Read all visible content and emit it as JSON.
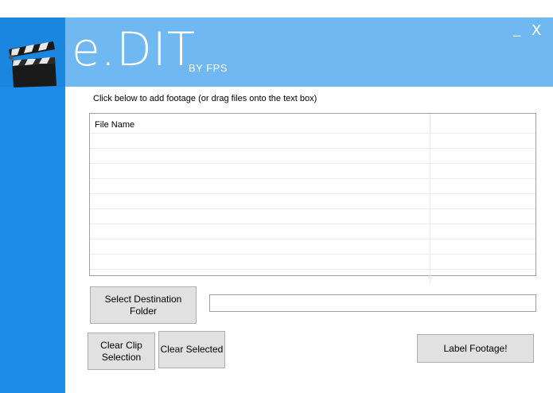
{
  "header": {
    "brand_main": "e.DIT",
    "brand_sub": "BY FPS",
    "minimize_label": "_",
    "close_label": "X"
  },
  "instructions": "Click below to add footage (or drag files onto the text box)",
  "file_table": {
    "columns": [
      "File Name",
      ""
    ],
    "rows": []
  },
  "buttons": {
    "select_destination": "Select Destination Folder",
    "clear_clip_selection": "Clear Clip Selection",
    "clear_selected": "Clear Selected",
    "label_footage": "Label Footage!"
  },
  "destination_field": {
    "value": ""
  },
  "colors": {
    "sidebar": "#1d8ce8",
    "header": "#6fb8f2",
    "button": "#e1e1e1"
  }
}
